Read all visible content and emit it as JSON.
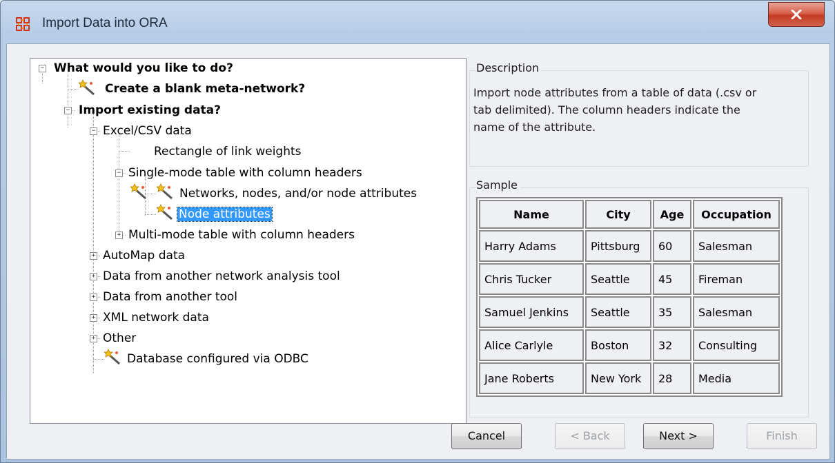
{
  "window": {
    "title": "Import Data into ORA"
  },
  "tree": {
    "root": "What would you like to do?",
    "create_blank": "Create a blank meta-network?",
    "import_existing": "Import existing data?",
    "excel_csv": "Excel/CSV data",
    "rect_link_weights": "Rectangle of link weights",
    "single_mode": "Single-mode table with column headers",
    "networks_nodes": "Networks, nodes, and/or node attributes",
    "node_attributes": "Node attributes",
    "multi_mode": "Multi-mode table with column headers",
    "automap": "AutoMap data",
    "other_network_tool": "Data from another network analysis tool",
    "other_tool": "Data from another tool",
    "xml": "XML network data",
    "other": "Other",
    "odbc": "Database configured via ODBC"
  },
  "description": {
    "label": "Description",
    "line1": "Import node attributes from a table of data (.csv or",
    "line2": "tab delimited). The column headers indicate the",
    "line3": "name of the attribute."
  },
  "sample": {
    "label": "Sample",
    "headers": [
      "Name",
      "City",
      "Age",
      "Occupation"
    ],
    "rows": [
      [
        "Harry Adams",
        "Pittsburg",
        "60",
        "Salesman"
      ],
      [
        "Chris Tucker",
        "Seattle",
        "45",
        "Fireman"
      ],
      [
        "Samuel Jenkins",
        "Seattle",
        "35",
        "Salesman"
      ],
      [
        "Alice Carlyle",
        "Boston",
        "32",
        "Consulting"
      ],
      [
        "Jane Roberts",
        "New York",
        "28",
        "Media"
      ]
    ]
  },
  "buttons": {
    "cancel": "Cancel",
    "back": "< Back",
    "next": "Next >",
    "finish": "Finish"
  },
  "colors": {
    "selection": "#3399ff",
    "close_button": "#c43b24"
  }
}
